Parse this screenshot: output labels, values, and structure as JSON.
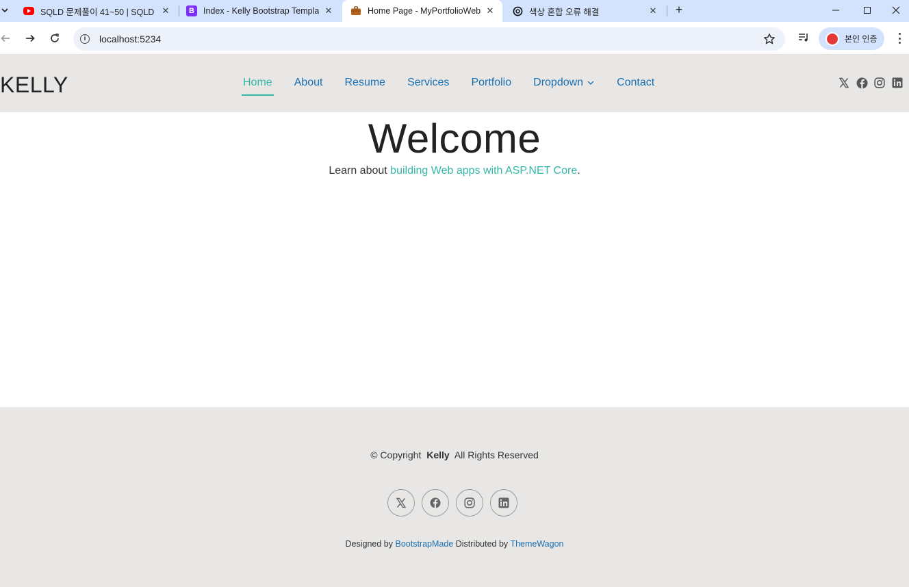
{
  "browser": {
    "tabs": [
      {
        "title": "SQLD 문제풀이 41~50 | SQLD",
        "icon": "youtube-icon",
        "active": false
      },
      {
        "title": "Index - Kelly Bootstrap Template",
        "icon": "bootstrap-icon",
        "active": false
      },
      {
        "title": "Home Page - MyPortfolioWebApp",
        "icon": "briefcase-icon",
        "active": true
      },
      {
        "title": "색상 혼합 오류 해결",
        "icon": "openai-icon",
        "active": false
      }
    ],
    "url": "localhost:5234",
    "profile_label": "본인 인증"
  },
  "site": {
    "logo": "KELLY",
    "nav": {
      "home": "Home",
      "about": "About",
      "resume": "Resume",
      "services": "Services",
      "portfolio": "Portfolio",
      "dropdown": "Dropdown",
      "contact": "Contact"
    },
    "accent_color": "#34b7a7",
    "link_color": "#1a6fb0"
  },
  "main": {
    "heading": "Welcome",
    "lead_prefix": "Learn about ",
    "lead_link": "building Web apps with ASP.NET Core",
    "lead_suffix": "."
  },
  "footer": {
    "copyright_prefix": "© Copyright",
    "copyright_name": "Kelly",
    "copyright_suffix": "All Rights Reserved",
    "designed_by": "Designed by",
    "designer_link": "BootstrapMade",
    "distributed_by": "Distributed by",
    "distributor_link": "ThemeWagon"
  }
}
